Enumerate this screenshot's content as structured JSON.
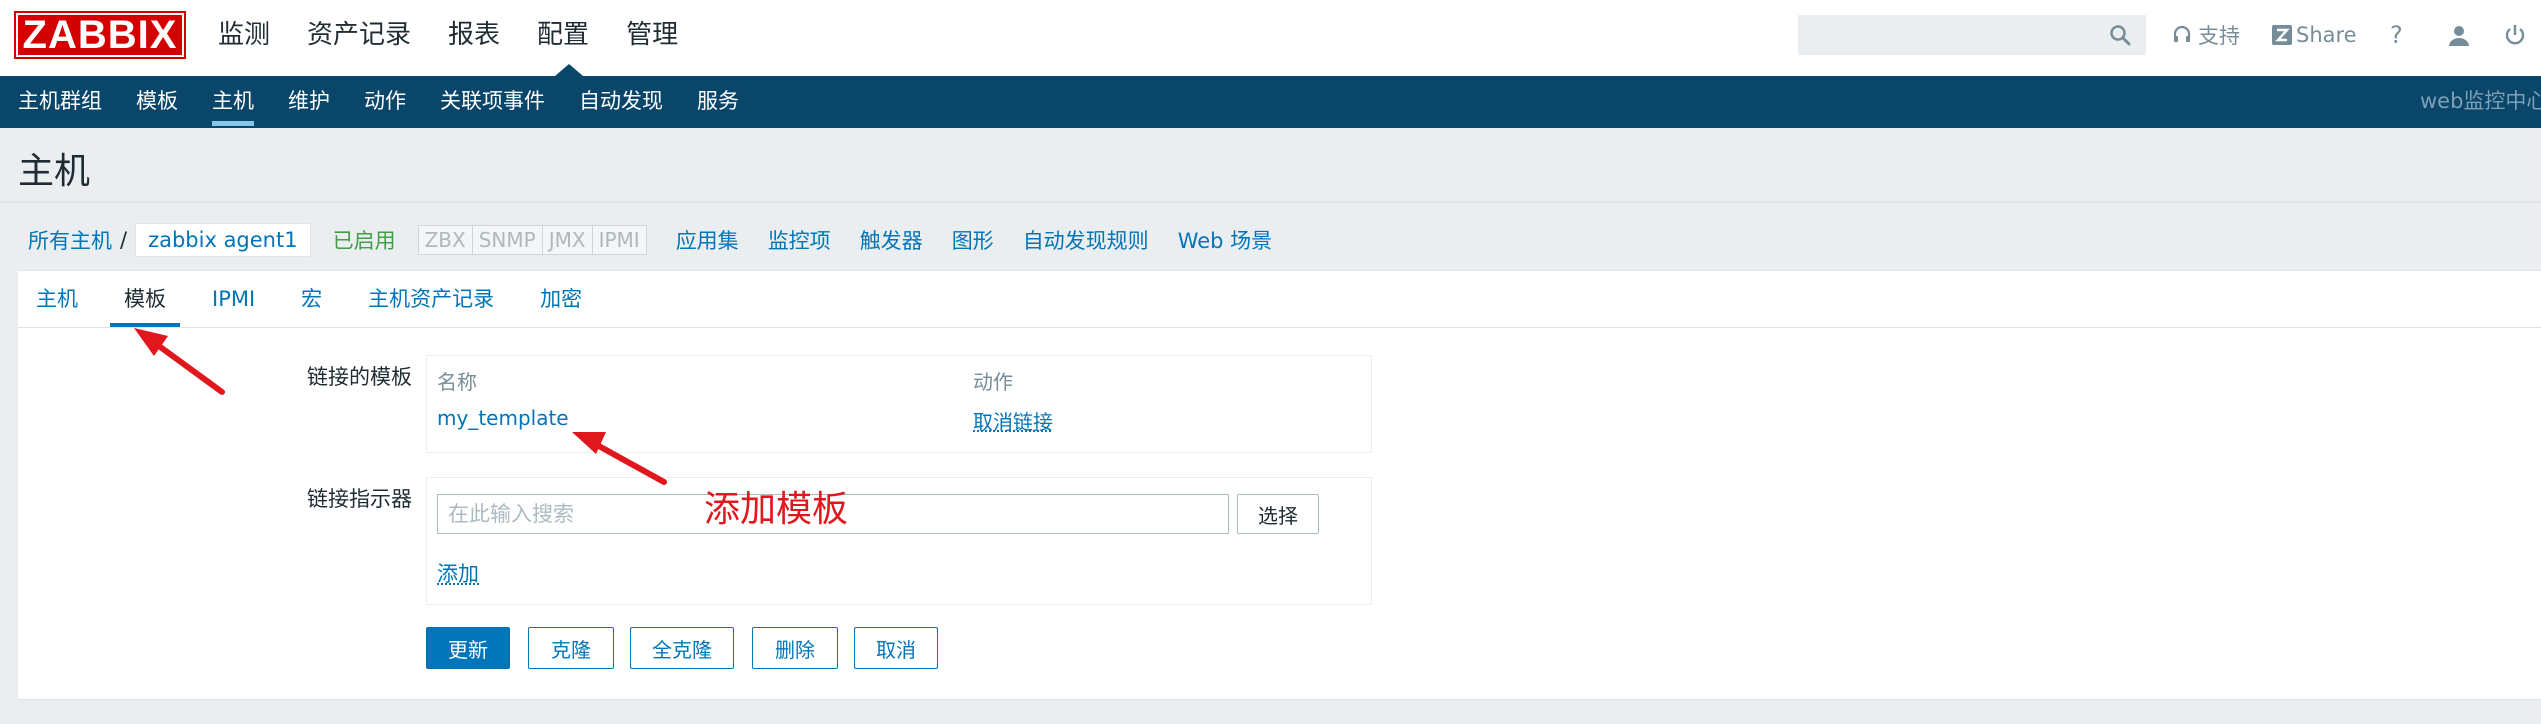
{
  "logo": "ZABBIX",
  "main_nav": [
    "监测",
    "资产记录",
    "报表",
    "配置",
    "管理"
  ],
  "search": {
    "placeholder": ""
  },
  "top_right": {
    "support": "支持",
    "share": "Share",
    "help": "?"
  },
  "sub_nav": [
    "主机群组",
    "模板",
    "主机",
    "维护",
    "动作",
    "关联项事件",
    "自动发现",
    "服务"
  ],
  "sub_nav_right": "web监控中心",
  "page_title": "主机",
  "breadcrumb": {
    "all_hosts": "所有主机",
    "separator": "/",
    "current": "zabbix agent1",
    "status": "已启用",
    "tags": [
      "ZBX",
      "SNMP",
      "JMX",
      "IPMI"
    ],
    "links": [
      "应用集",
      "监控项",
      "触发器",
      "图形",
      "自动发现规则",
      "Web 场景"
    ]
  },
  "tabs": [
    "主机",
    "模板",
    "IPMI",
    "宏",
    "主机资产记录",
    "加密"
  ],
  "linked_templates": {
    "label": "链接的模板",
    "col_name": "名称",
    "col_action": "动作",
    "template_name": "my_template",
    "unlink": "取消链接"
  },
  "link_indicator": {
    "label": "链接指示器",
    "placeholder": "在此输入搜索",
    "select": "选择",
    "add": "添加"
  },
  "buttons": {
    "update": "更新",
    "clone": "克隆",
    "full_clone": "全克隆",
    "delete": "删除",
    "cancel": "取消"
  },
  "annotation": "添加模板",
  "colors": {
    "header_bg": "#0a466a",
    "link": "#0275b8",
    "logo": "#d40000",
    "enabled": "#429e47",
    "annotation": "#e0171d"
  }
}
